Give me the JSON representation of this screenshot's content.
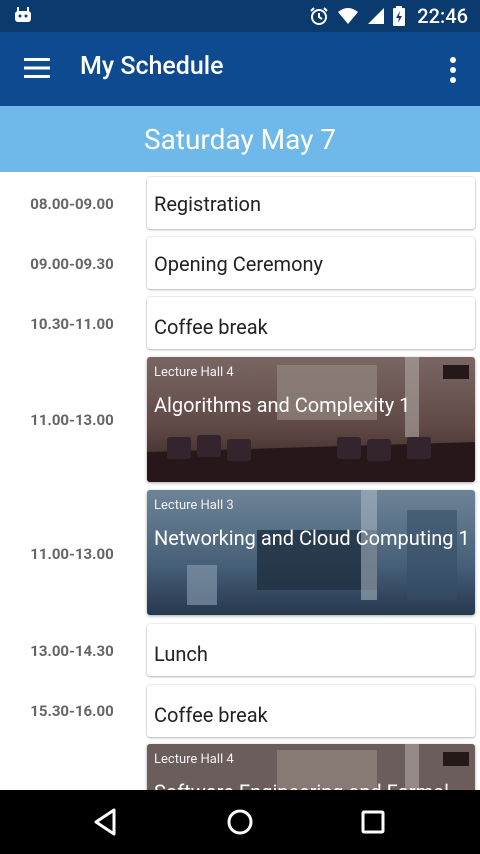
{
  "status_bar": {
    "time": "22:46",
    "icons": [
      "android-icon",
      "alarm-icon",
      "wifi-icon",
      "signal-icon",
      "battery-icon"
    ]
  },
  "app_bar": {
    "title": "My Schedule",
    "left_icon": "hamburger-menu-icon",
    "right_icon": "more-vert-icon"
  },
  "date_header": "Saturday May 7",
  "sessions": [
    {
      "time": "08.00-09.00",
      "title": "Registration",
      "kind": "plain"
    },
    {
      "time": "09.00-09.30",
      "title": "Opening Ceremony",
      "kind": "plain"
    },
    {
      "time": "10.30-11.00",
      "title": "Coffee break",
      "kind": "plain"
    },
    {
      "time": "11.00-13.00",
      "venue": "Lecture Hall 4",
      "title": "Algorithms and Complexity 1",
      "kind": "lecture"
    },
    {
      "time": "11.00-13.00",
      "venue": "Lecture Hall 3",
      "title": "Networking and Cloud Computing 1",
      "kind": "lecture"
    },
    {
      "time": "13.00-14.30",
      "title": "Lunch",
      "kind": "plain"
    },
    {
      "time": "15.30-16.00",
      "title": "Coffee break",
      "kind": "plain"
    },
    {
      "venue": "Lecture Hall 4",
      "title": "Software Engineering and Formal",
      "kind": "lecture"
    }
  ],
  "nav_bar": {
    "buttons": [
      "back-icon",
      "home-icon",
      "recents-icon"
    ]
  },
  "colors": {
    "status_bar": "#0b3a6f",
    "app_bar": "#0d4a8f",
    "date_bar": "#6fb8ea",
    "time_text": "#666666"
  }
}
